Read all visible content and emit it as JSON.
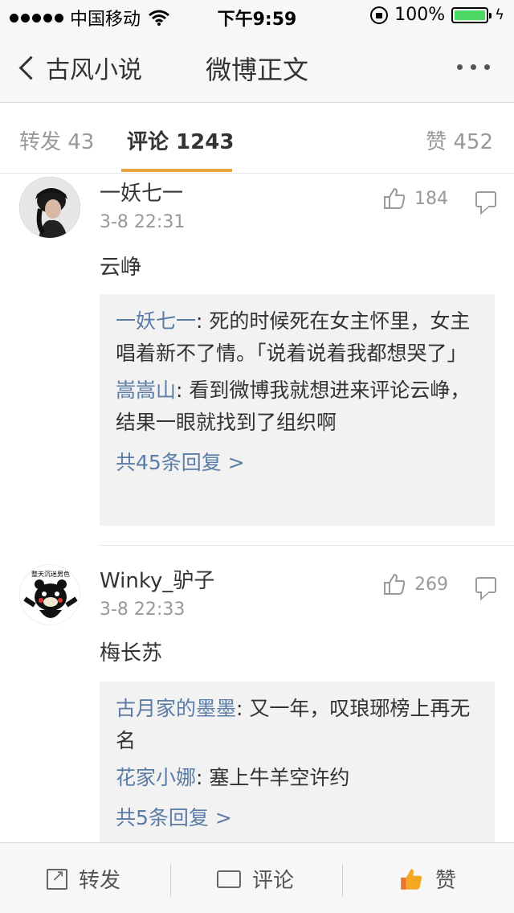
{
  "status_bar": {
    "carrier": "中国移动",
    "time": "下午9:59",
    "battery": "100%"
  },
  "nav": {
    "back_label": "古风小说",
    "title": "微博正文"
  },
  "tabs": {
    "repost": "转发 43",
    "comments": "评论 1243",
    "likes": "赞 452"
  },
  "comments": [
    {
      "name": "一妖七一",
      "time": "3-8 22:31",
      "likes": "184",
      "text": "云峥",
      "replies": [
        {
          "author": "一妖七一",
          "text": ": 死的时候死在女主怀里，女主唱着新不了情。「说着说着我都想哭了」"
        },
        {
          "author": "嵩嵩山",
          "text": ": 看到微博我就想进来评论云峥，结果一眼就找到了组织啊"
        }
      ],
      "more": "共45条回复 >"
    },
    {
      "name": "Winky_驴子",
      "time": "3-8 22:33",
      "likes": "269",
      "text": "梅长苏",
      "avatar_caption": "整天沉迷男色",
      "replies": [
        {
          "author": "古月家的墨墨",
          "text": ": 又一年，叹琅琊榜上再无名"
        },
        {
          "author": "花家小娜",
          "text": ": 塞上牛羊空许约"
        }
      ],
      "more": "共5条回复 >"
    }
  ],
  "bottom_bar": {
    "repost": "转发",
    "comment": "评论",
    "like": "赞"
  },
  "colors": {
    "accent": "#e8a23d",
    "link": "#5a7ca6",
    "battery": "#4cd964"
  }
}
